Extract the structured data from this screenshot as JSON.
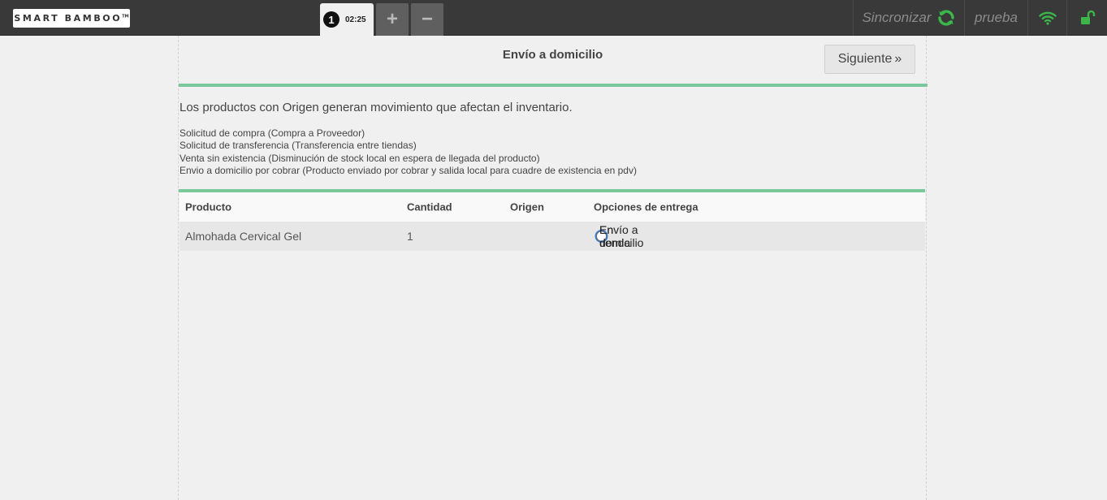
{
  "header": {
    "logo_text": "SMART BAMBOO",
    "logo_mark": "TM",
    "ticket_number": "1",
    "ticket_time": "02:25",
    "add_tab": "+",
    "remove_tab": "−",
    "sync_label": "Sincronizar",
    "user_name": "prueba",
    "icons": [
      "sync-icon",
      "wifi-icon",
      "unlock-icon"
    ],
    "accent_green": "#3cb54a"
  },
  "panel": {
    "title": "Envío a domicilio",
    "next_label": "Siguiente",
    "next_icon": "»",
    "info_main": "Los productos con Origen generan movimiento que afectan el inventario.",
    "info_lines": [
      "Solicitud de compra (Compra a Proveedor)",
      "Solicitud de transferencia (Transferencia entre tiendas)",
      "Venta sin existencia (Disminución de stock local en espera de llegada del producto)",
      "Envio a domicilio por cobrar (Producto enviado por cobrar y salida local para cuadre de existencia en pdv)"
    ]
  },
  "table": {
    "headers": [
      "Producto",
      "Cantidad",
      "Origen",
      "Opciones de entrega"
    ],
    "rows": [
      {
        "producto": "Almohada Cervical Gel",
        "cantidad": "1",
        "origen": "",
        "options": [
          "En tienda",
          "Envío a domicilio"
        ],
        "selected": "En tienda"
      }
    ]
  }
}
